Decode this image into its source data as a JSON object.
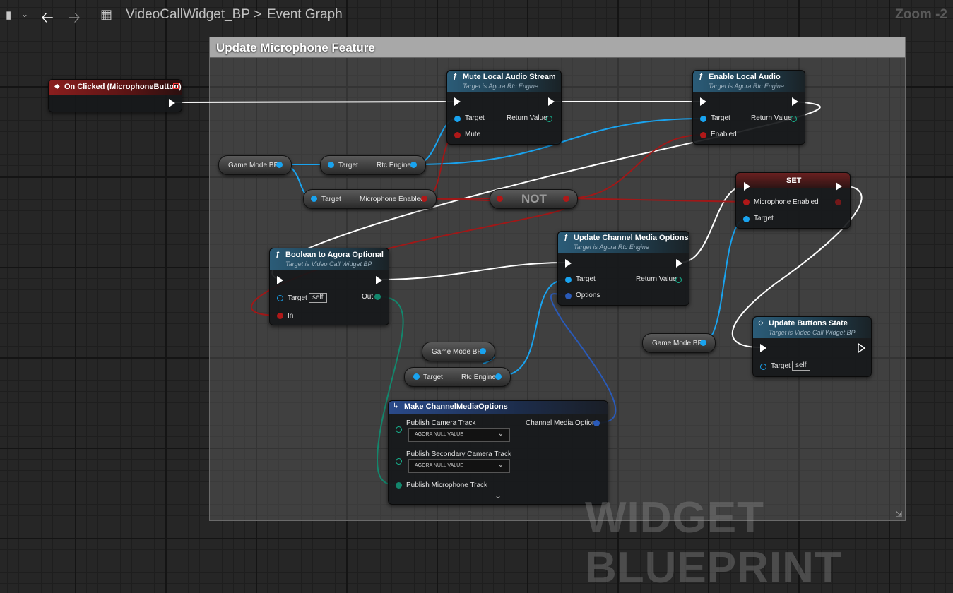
{
  "header": {
    "graph_name": "VideoCallWidget_BP",
    "separator": ">",
    "graph_section": "Event Graph",
    "zoom": "Zoom -2"
  },
  "comment": {
    "title": "Update Microphone Feature"
  },
  "watermark": "WIDGET BLUEPRINT",
  "nodes": {
    "on_clicked": {
      "title": "On Clicked (MicrophoneButton)"
    },
    "mute": {
      "title": "Mute Local Audio Stream",
      "subtitle": "Target is Agora Rtc Engine",
      "pins": [
        "Target",
        "Mute",
        "Return Value"
      ]
    },
    "enable": {
      "title": "Enable Local Audio",
      "subtitle": "Target is Agora Rtc Engine",
      "pins": [
        "Target",
        "Enabled",
        "Return Value"
      ]
    },
    "game_mode_1": {
      "label": "Game Mode BP"
    },
    "rtc_engine_1": {
      "left": "Target",
      "right": "Rtc Engine"
    },
    "mic_enabled_get": {
      "left": "Target",
      "right": "Microphone Enabled"
    },
    "not": {
      "label": "NOT"
    },
    "set": {
      "title": "SET",
      "pins": [
        "Microphone Enabled",
        "Target"
      ]
    },
    "bool_to_agora": {
      "title": "Boolean to Agora Optional",
      "subtitle": "Target is Video Call Widget BP",
      "pins": [
        "Target",
        "In",
        "Out"
      ],
      "self": "self"
    },
    "update_channel": {
      "title": "Update Channel Media Options",
      "subtitle": "Target is Agora Rtc Engine",
      "pins": [
        "Target",
        "Options",
        "Return Value"
      ]
    },
    "game_mode_2": {
      "label": "Game Mode BP"
    },
    "rtc_engine_2": {
      "left": "Target",
      "right": "Rtc Engine"
    },
    "game_mode_3": {
      "label": "Game Mode BP"
    },
    "update_buttons": {
      "title": "Update Buttons State",
      "subtitle": "Target is Video Call Widget BP",
      "pins": [
        "Target"
      ],
      "self": "self"
    },
    "make_options": {
      "title": "Make ChannelMediaOptions",
      "pins": [
        "Publish Camera Track",
        "Publish Secondary Camera Track",
        "Publish Microphone Track",
        "Channel Media Options"
      ],
      "dropdown_value": "AGORA NULL VALUE"
    }
  },
  "colors": {
    "exec": "#ffffff",
    "object": "#19a3ef",
    "bool": "#b01818",
    "struct": "#13866c"
  }
}
